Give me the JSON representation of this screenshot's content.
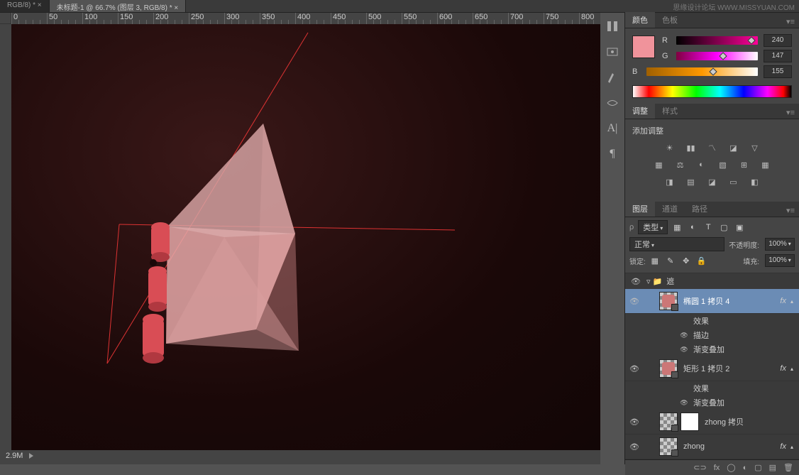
{
  "tabs": [
    {
      "label": "RGB/8) * ×"
    },
    {
      "label": "未标题-1 @ 66.7% (图层 3, RGB/8) * ×"
    }
  ],
  "ruler": [
    "0",
    "50",
    "100",
    "150",
    "200",
    "250",
    "300",
    "350",
    "400",
    "450",
    "500",
    "550",
    "600",
    "650",
    "700",
    "750",
    "800"
  ],
  "watermark": "思缘设计论坛  WWW.MISSYUAN.COM",
  "status": {
    "size": "2.9M"
  },
  "color": {
    "tab_color": "颜色",
    "tab_swatch": "色板",
    "r_label": "R",
    "r_value": "240",
    "g_label": "G",
    "g_value": "147",
    "b_label": "B",
    "b_value": "155"
  },
  "adjust": {
    "tab_adjust": "调整",
    "tab_style": "样式",
    "title": "添加调整"
  },
  "layers": {
    "tab_layers": "图层",
    "tab_channels": "通道",
    "tab_paths": "路径",
    "kind_label": "类型",
    "blend_mode": "正常",
    "opacity_label": "不透明度:",
    "opacity_value": "100%",
    "lock_label": "锁定:",
    "fill_label": "填充:",
    "fill_value": "100%",
    "group_name": "遮",
    "fx_label": "fx",
    "effects_label": "效果",
    "stroke_label": "描边",
    "gradient_label": "渐变叠加",
    "items": [
      {
        "name": "椭圆 1 拷贝 4"
      },
      {
        "name": "矩形 1 拷贝 2"
      },
      {
        "name": "zhong 拷贝"
      },
      {
        "name": "zhong"
      }
    ]
  }
}
